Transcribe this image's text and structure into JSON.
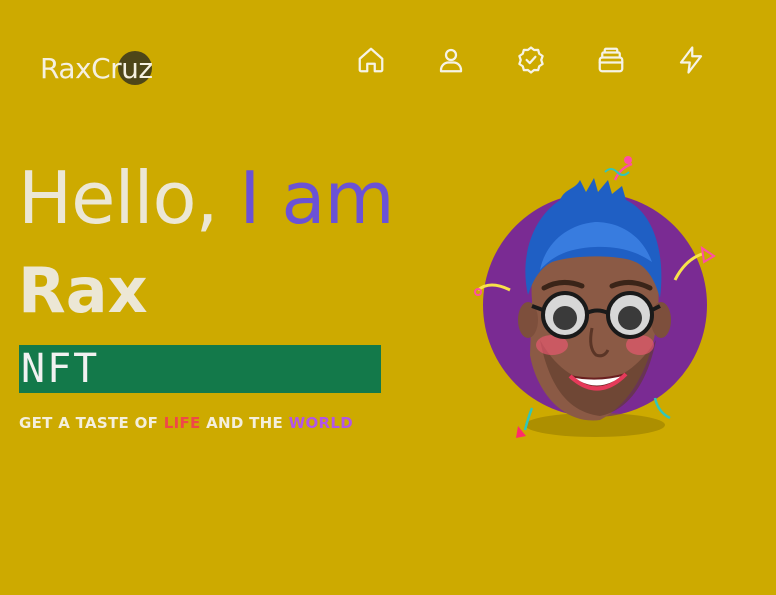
{
  "brand": {
    "logo_text": "RaxCr",
    "logo_accent": "uz"
  },
  "nav": [
    {
      "icon": "home-icon"
    },
    {
      "icon": "user-icon"
    },
    {
      "icon": "badge-check-icon"
    },
    {
      "icon": "stack-icon"
    },
    {
      "icon": "bolt-icon"
    }
  ],
  "hero": {
    "greeting": "Hello, ",
    "greeting_accent": "I am",
    "name": "Rax",
    "role": "NFT",
    "tagline_start": "GET A TASTE OF ",
    "tagline_life": "LIFE",
    "tagline_mid": " AND THE ",
    "tagline_world": "WORLD"
  },
  "colors": {
    "background": "#cdaa00",
    "accent": "#6b52d6",
    "nft_box": "#13794a",
    "life": "#ef4848",
    "world": "#b255e8"
  }
}
